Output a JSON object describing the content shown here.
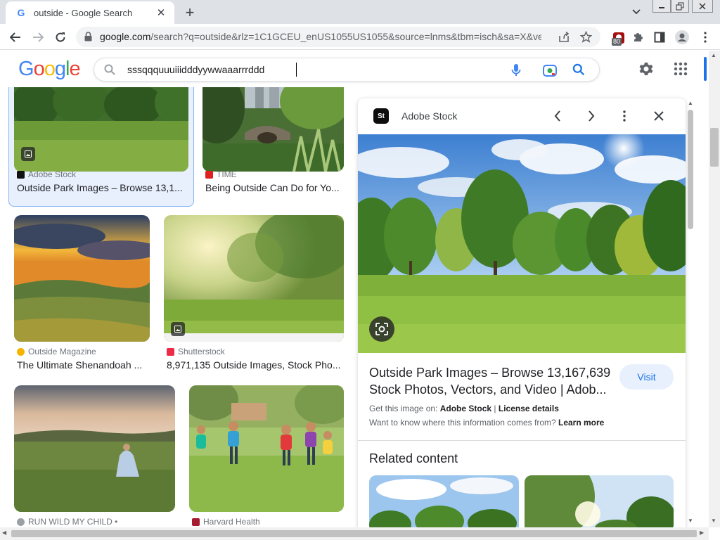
{
  "browser": {
    "tab_title": "outside - Google Search",
    "favicon_letter": "G",
    "url_host": "google.com",
    "url_rest": "/search?q=outside&rlz=1C1GCEU_enUS1055US1055&source=lnms&tbm=isch&sa=X&ve...",
    "extension_badge": "80"
  },
  "google": {
    "logo_letters": [
      "G",
      "o",
      "o",
      "g",
      "l",
      "e"
    ],
    "query": "sssqqquuuiiidddyywwaaarrrddd"
  },
  "results": [
    {
      "source": "Adobe Stock",
      "caption": "Outside Park Images – Browse 13,1...",
      "icon_color": "#111111"
    },
    {
      "source": "TIME",
      "caption": "Being Outside Can Do for Yo...",
      "icon_color": "#e02020"
    },
    {
      "source": "Outside Magazine",
      "caption": "The Ultimate Shenandoah ...",
      "icon_color": "#f4b400"
    },
    {
      "source": "Shutterstock",
      "caption": "8,971,135 Outside Images, Stock Pho...",
      "icon_color": "#ee2b47"
    },
    {
      "source": "RUN WILD MY CHILD •",
      "caption": "",
      "icon_color": "#9aa0a6"
    },
    {
      "source": "Harvard Health",
      "caption": "",
      "icon_color": "#a51c30"
    }
  ],
  "panel": {
    "source_name": "Adobe Stock",
    "source_logo": "St",
    "title": "Outside Park Images – Browse 13,167,639 Stock Photos, Vectors, and Video | Adob...",
    "visit_label": "Visit",
    "get_image_prefix": "Get this image on: ",
    "get_image_source": "Adobe Stock",
    "separator": " | ",
    "license_label": "License details",
    "info_question": "Want to know where this information comes from? ",
    "learn_more": "Learn more",
    "related_heading": "Related content"
  },
  "colors": {
    "accent_blue": "#1a73e8",
    "visit_bg": "#e8f0fe"
  }
}
